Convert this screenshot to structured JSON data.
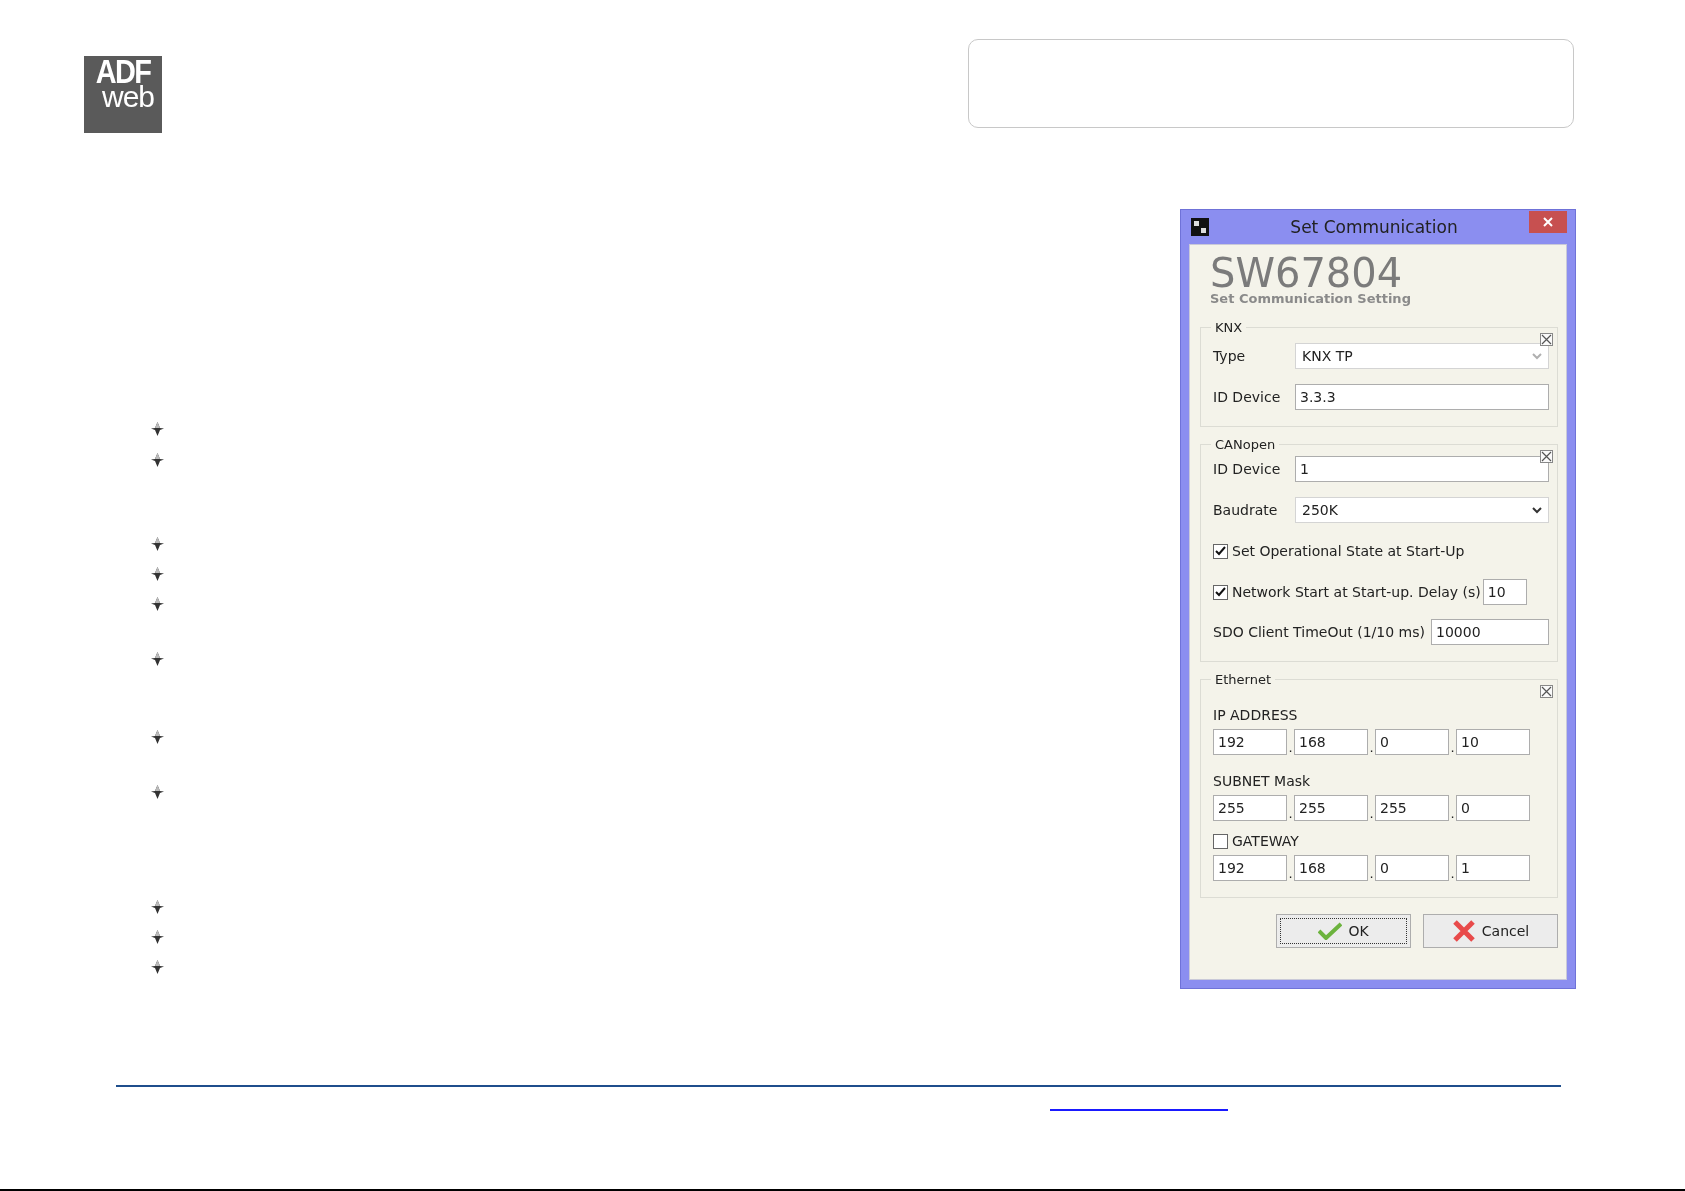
{
  "logo": {
    "line_1": "ADF",
    "line_2": "web"
  },
  "dialog": {
    "title": "Set Communication",
    "product": "SW67804",
    "subtitle": "Set Communication Setting",
    "knx": {
      "legend": "KNX",
      "type_label": "Type",
      "type_value": "KNX TP",
      "type_disabled": true,
      "id_label": "ID Device",
      "id_value": "3.3.3"
    },
    "canopen": {
      "legend": "CANopen",
      "id_label": "ID Device",
      "id_value": "1",
      "baudrate_label": "Baudrate",
      "baudrate_value": "250K",
      "baudrate_disabled": false,
      "options": [
        {
          "label": "Set Operational State at Start-Up",
          "checked": true
        },
        {
          "label": "Network Start at Start-up. Delay (s)",
          "checked": true,
          "value": "10"
        }
      ],
      "sdo_label": "SDO Client TimeOut (1/10 ms)",
      "sdo_value": "10000"
    },
    "ethernet": {
      "legend": "Ethernet",
      "addresses": [
        {
          "kind": "plain",
          "label": "IP ADDRESS",
          "octets": [
            "192",
            "168",
            "0",
            "10"
          ],
          "separators": [
            ".",
            ".",
            "."
          ]
        },
        {
          "kind": "plain",
          "label": "SUBNET Mask",
          "octets": [
            "255",
            "255",
            "255",
            "0"
          ],
          "separators": [
            ".",
            ".",
            "."
          ]
        },
        {
          "kind": "checkbox",
          "label": "GATEWAY",
          "checked": false,
          "octets": [
            "192",
            "168",
            "0",
            "1"
          ],
          "separators": [
            ".",
            ".",
            "."
          ]
        }
      ]
    },
    "buttons": [
      {
        "kind": "ok",
        "label": "OK",
        "focused": true
      },
      {
        "kind": "cancel",
        "label": "Cancel",
        "focused": false
      }
    ]
  }
}
